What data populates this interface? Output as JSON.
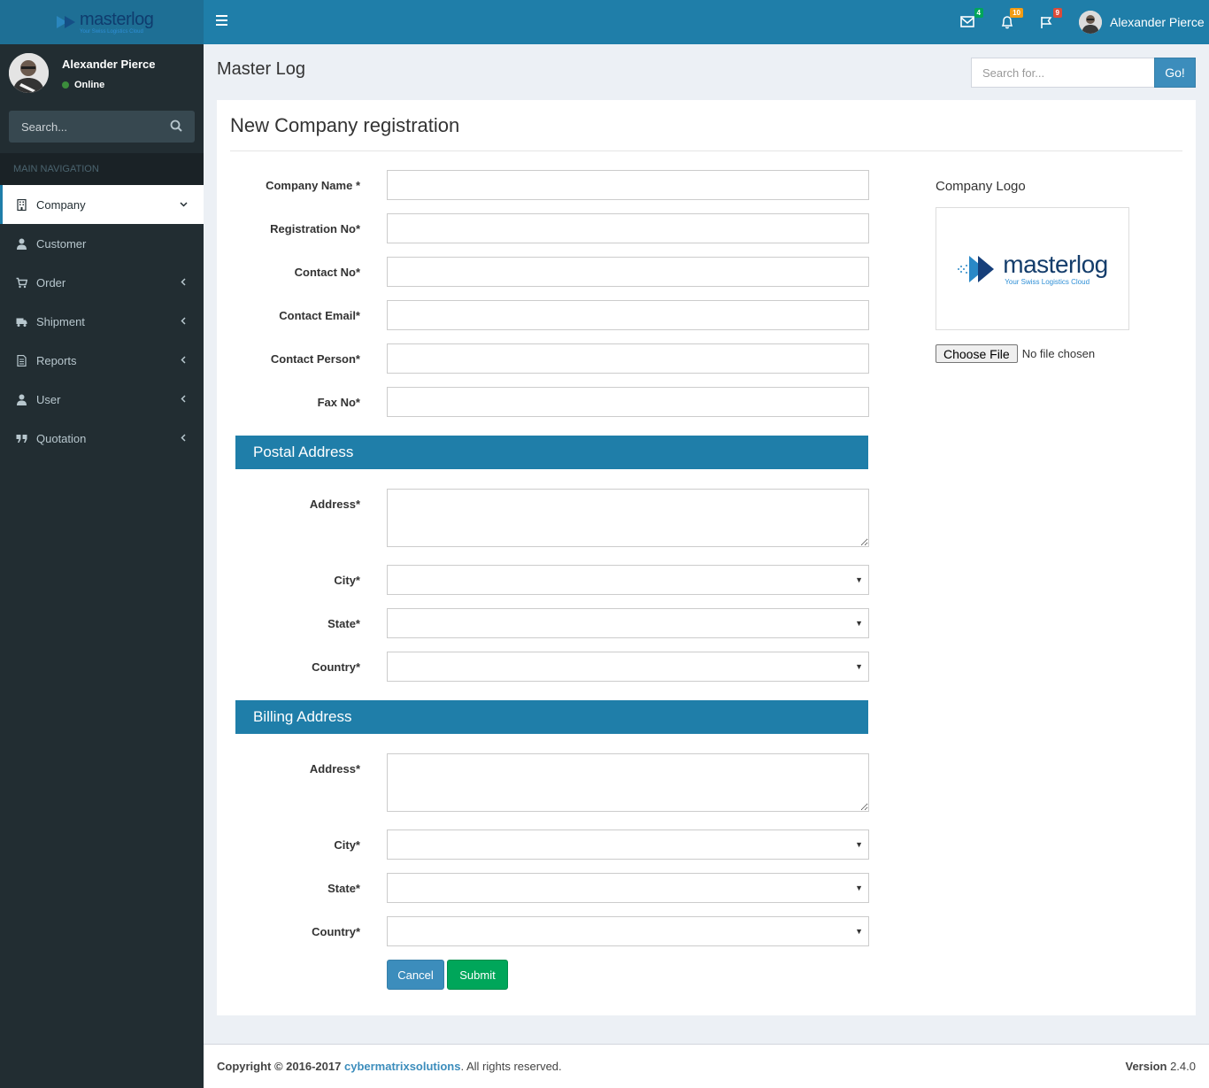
{
  "brand": {
    "name": "masterlog",
    "tagline": "Your Swiss Logistics Cloud"
  },
  "topnav": {
    "messages_count": "4",
    "notifications_count": "10",
    "tasks_count": "9",
    "user_name": "Alexander Pierce",
    "colors": {
      "messages": "#00a65a",
      "notifications": "#f39c12",
      "tasks": "#dd4b39"
    }
  },
  "sidebar": {
    "user_name": "Alexander Pierce",
    "status": "Online",
    "search_placeholder": "Search...",
    "nav_header": "MAIN NAVIGATION",
    "items": [
      {
        "label": "Company",
        "icon": "building-icon",
        "active": true
      },
      {
        "label": "Customer",
        "icon": "user-icon"
      },
      {
        "label": "Order",
        "icon": "cart-icon"
      },
      {
        "label": "Shipment",
        "icon": "truck-icon"
      },
      {
        "label": "Reports",
        "icon": "file-text-icon"
      },
      {
        "label": "User",
        "icon": "user-icon"
      },
      {
        "label": "Quotation",
        "icon": "quote-icon"
      }
    ]
  },
  "content": {
    "page_title": "Master Log",
    "search_placeholder": "Search for...",
    "search_button": "Go!"
  },
  "form": {
    "title": "New Company registration",
    "fields": {
      "company_name": "Company Name *",
      "registration_no": "Registration No*",
      "contact_no": "Contact No*",
      "contact_email": "Contact Email*",
      "contact_person": "Contact Person*",
      "fax_no": "Fax No*"
    },
    "postal": {
      "heading": "Postal Address",
      "address": "Address*",
      "city": "City*",
      "state": "State*",
      "country": "Country*"
    },
    "billing": {
      "heading": "Billing Address",
      "address": "Address*",
      "city": "City*",
      "state": "State*",
      "country": "Country*"
    },
    "cancel_label": "Cancel",
    "submit_label": "Submit",
    "logo_label": "Company Logo",
    "choose_file_label": "Choose File",
    "no_file_label": "No file chosen"
  },
  "footer": {
    "copyright": "Copyright © 2016-2017",
    "company_link": "cybermatrixsolutions",
    "rights": ". All rights reserved.",
    "version_label": "Version",
    "version_value": "2.4.0"
  }
}
